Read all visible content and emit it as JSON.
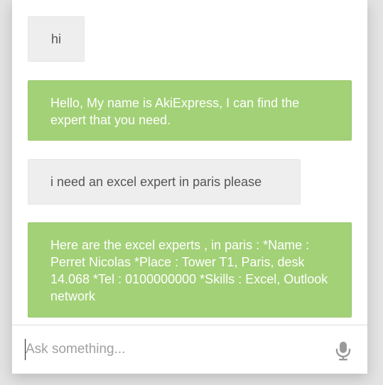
{
  "chat": {
    "messages": [
      {
        "role": "user",
        "text": "hi"
      },
      {
        "role": "bot",
        "text": "Hello, My name is AkiExpress, I can find the expert that you need."
      },
      {
        "role": "user",
        "text": "i need an excel expert in paris please"
      },
      {
        "role": "bot",
        "text": "Here are the excel experts , in paris : *Name : Perret Nicolas *Place : Tower T1, Paris, desk 14.068 *Tel : 0100000000 *Skills : Excel, Outlook network"
      }
    ]
  },
  "composer": {
    "placeholder": "Ask something...",
    "value": "",
    "mic_icon": "microphone-icon"
  },
  "colors": {
    "bot_bubble": "#a3d177",
    "user_bubble": "#eeeeee",
    "background": "#e3e3e3"
  }
}
